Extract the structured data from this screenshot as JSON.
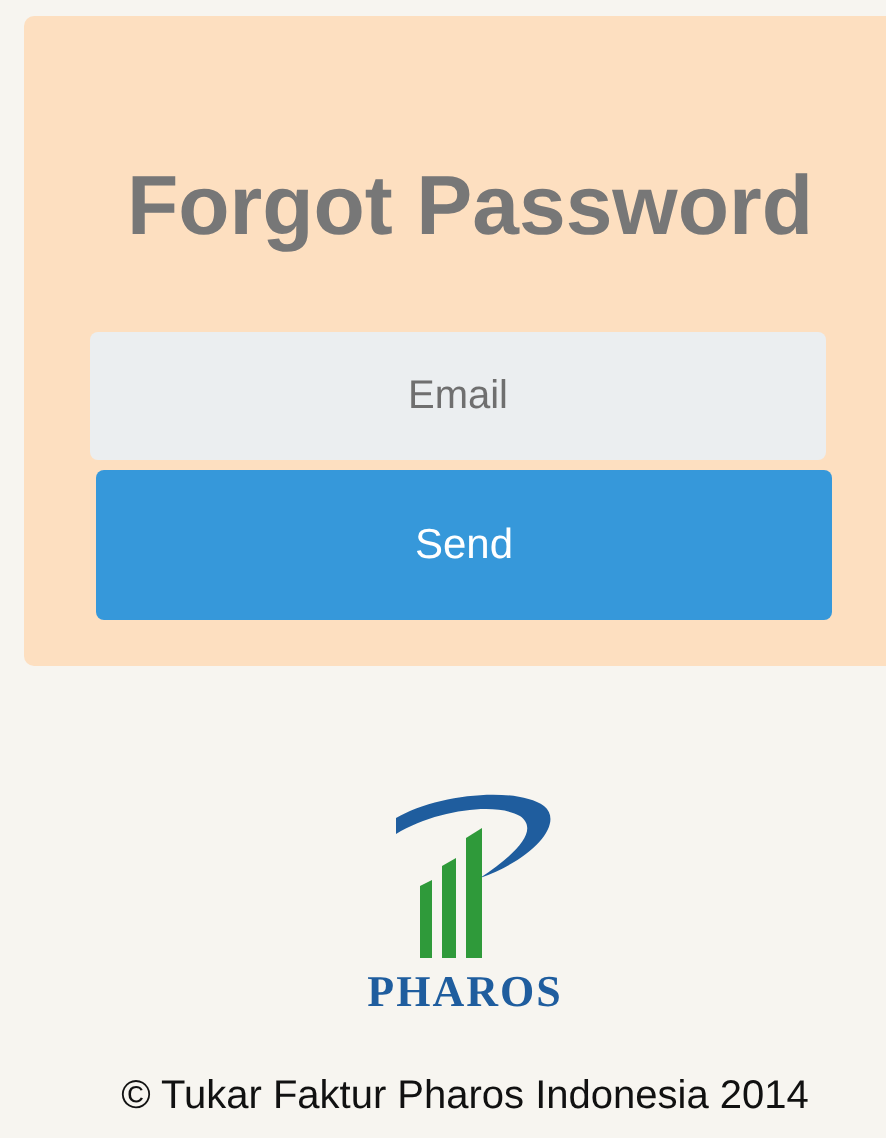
{
  "title": "Forgot Password",
  "email_field": {
    "placeholder": "Email"
  },
  "send_button": {
    "label": "Send"
  },
  "logo": {
    "wordmark": "PHAROS"
  },
  "footer": "© Tukar Faktur Pharos Indonesia 2014"
}
